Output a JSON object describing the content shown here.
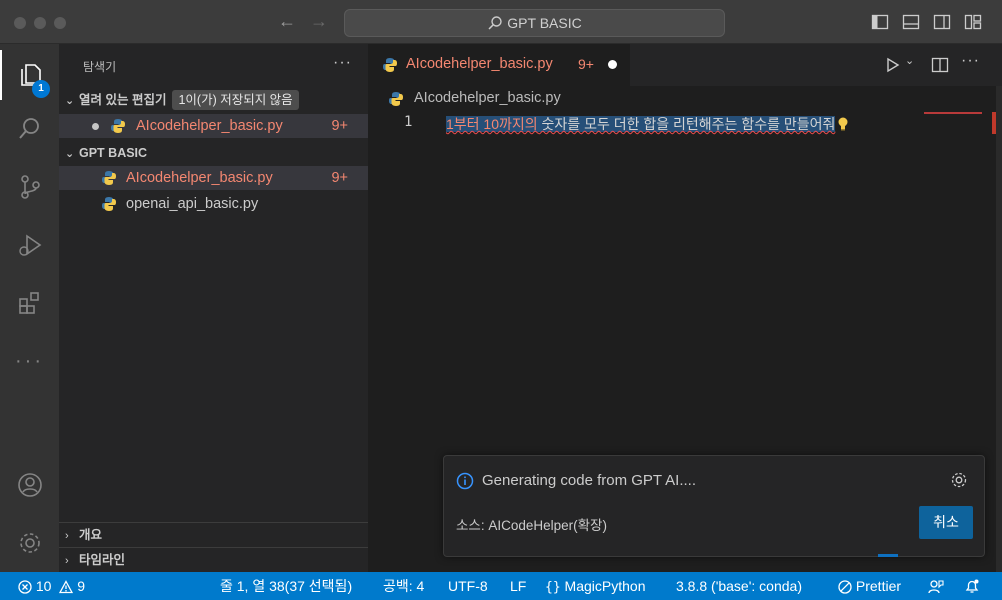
{
  "titlebar": {
    "search_text": "GPT BASIC"
  },
  "activitybar": {
    "explorer_badge": "1"
  },
  "sidebar": {
    "title": "탐색기",
    "more": "···",
    "open_editors": {
      "header": "열려 있는 편집기",
      "unsaved_badge": "1이(가) 저장되지 않음",
      "files": [
        {
          "name": "AIcodehelper_basic.py",
          "count": "9+"
        }
      ]
    },
    "folder": {
      "header": "GPT BASIC",
      "files": [
        {
          "name": "AIcodehelper_basic.py",
          "count": "9+"
        },
        {
          "name": "openai_api_basic.py",
          "count": ""
        }
      ]
    },
    "outline_label": "개요",
    "timeline_label": "타임라인"
  },
  "editor": {
    "tab": {
      "name": "AIcodehelper_basic.py",
      "count": "9+"
    },
    "breadcrumb": "AIcodehelper_basic.py",
    "line_number": "1",
    "code_part1": "1부터 10까지의",
    "code_part2": " 숫자를 모두 더한 합을 리턴해주는 함수를 만들어줘"
  },
  "notification": {
    "message": "Generating code from GPT AI....",
    "source": "소스: AICodeHelper(확장)",
    "cancel_label": "취소"
  },
  "statusbar": {
    "errors": "10",
    "warnings": "9",
    "position": "줄 1, 열 38(37 선택됨)",
    "spaces": "공백: 4",
    "encoding": "UTF-8",
    "eol": "LF",
    "language": "MagicPython",
    "interpreter": "3.8.8 ('base': conda)",
    "formatter": "Prettier"
  },
  "colors": {
    "accent": "#007acc",
    "error_text": "#f48771",
    "button": "#0e639c"
  }
}
